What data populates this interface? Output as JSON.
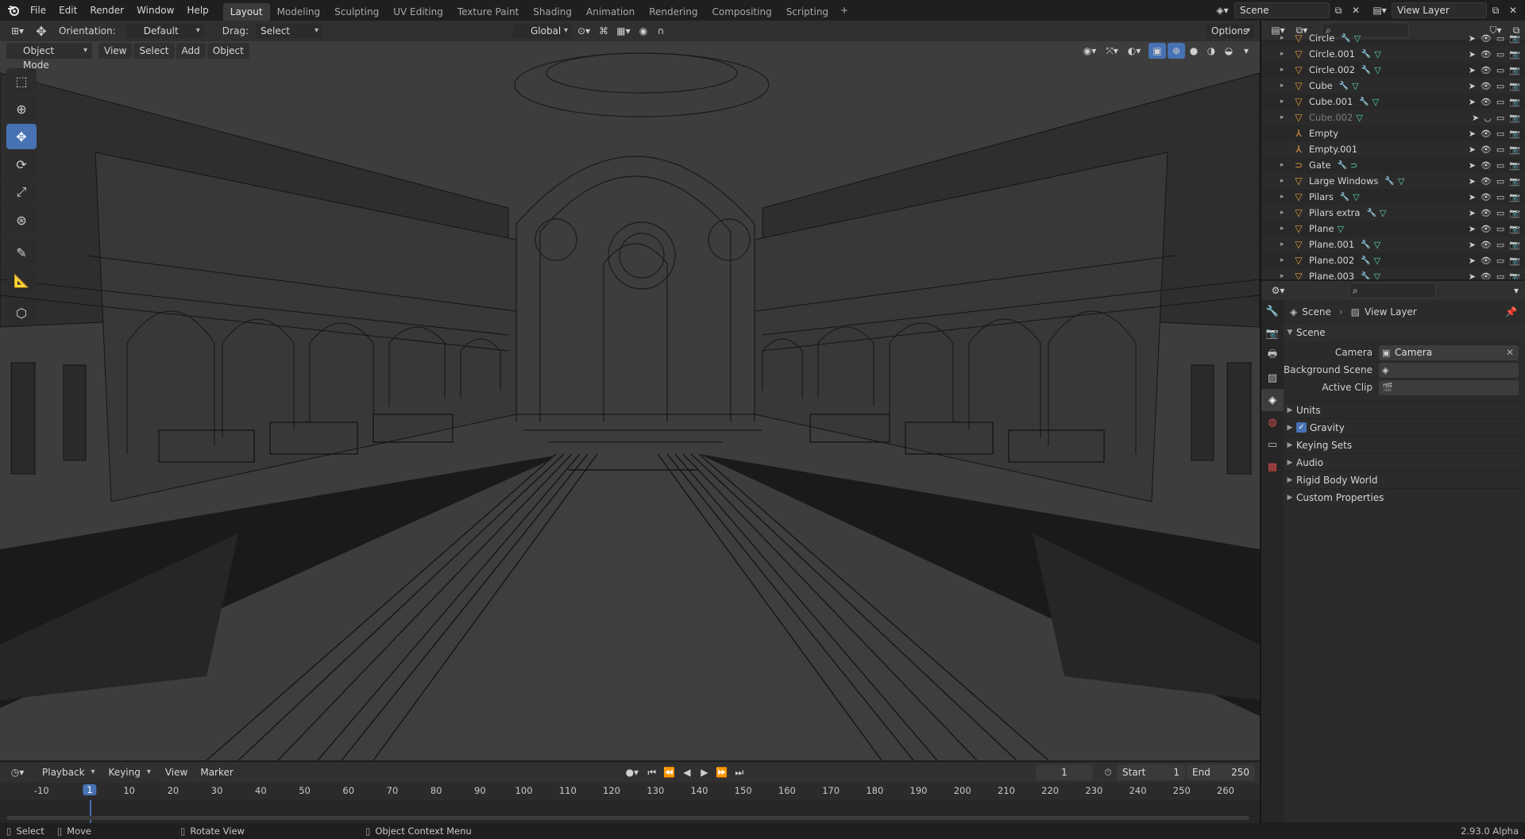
{
  "app": {
    "logo_icon": "blender-logo-icon"
  },
  "menu": [
    "File",
    "Edit",
    "Render",
    "Window",
    "Help"
  ],
  "workspaces": [
    "Layout",
    "Modeling",
    "Sculpting",
    "UV Editing",
    "Texture Paint",
    "Shading",
    "Animation",
    "Rendering",
    "Compositing",
    "Scripting"
  ],
  "active_workspace": "Layout",
  "scene_field": "Scene",
  "view_layer_field": "View Layer",
  "toolheader": {
    "orientation_label": "Orientation:",
    "orientation_value": "Default",
    "drag_label": "Drag:",
    "drag_value": "Select Box",
    "transform_orientation": "Global",
    "options": "Options"
  },
  "viewport_header": {
    "mode": "Object Mode",
    "menus": [
      "View",
      "Select",
      "Add",
      "Object"
    ]
  },
  "toolbar_icons": [
    "select-box-icon",
    "cursor-icon",
    "move-icon",
    "rotate-icon",
    "scale-icon",
    "transform-icon",
    "annotate-icon",
    "measure-icon",
    "add-cube-icon"
  ],
  "outliner": {
    "items": [
      {
        "name": "Circle",
        "mod": true,
        "data": true,
        "dim": false,
        "type": "mesh"
      },
      {
        "name": "Circle.001",
        "mod": true,
        "data": true,
        "dim": false,
        "type": "mesh"
      },
      {
        "name": "Circle.002",
        "mod": true,
        "data": true,
        "dim": false,
        "type": "mesh"
      },
      {
        "name": "Cube",
        "mod": true,
        "data": true,
        "dim": false,
        "type": "mesh"
      },
      {
        "name": "Cube.001",
        "mod": true,
        "data": true,
        "dim": false,
        "type": "mesh"
      },
      {
        "name": "Cube.002",
        "mod": false,
        "data": true,
        "dim": true,
        "type": "mesh"
      },
      {
        "name": "Empty",
        "mod": false,
        "data": false,
        "dim": false,
        "type": "empty"
      },
      {
        "name": "Empty.001",
        "mod": false,
        "data": false,
        "dim": false,
        "type": "empty"
      },
      {
        "name": "Gate",
        "mod": true,
        "data": true,
        "dim": false,
        "type": "curve"
      },
      {
        "name": "Large Windows",
        "mod": true,
        "data": true,
        "dim": false,
        "type": "mesh"
      },
      {
        "name": "Pilars",
        "mod": true,
        "data": true,
        "dim": false,
        "type": "mesh"
      },
      {
        "name": "Pilars extra",
        "mod": true,
        "data": true,
        "dim": false,
        "type": "mesh"
      },
      {
        "name": "Plane",
        "mod": false,
        "data": true,
        "dim": false,
        "type": "mesh"
      },
      {
        "name": "Plane.001",
        "mod": true,
        "data": true,
        "dim": false,
        "type": "mesh"
      },
      {
        "name": "Plane.002",
        "mod": true,
        "data": true,
        "dim": false,
        "type": "mesh"
      },
      {
        "name": "Plane.003",
        "mod": true,
        "data": true,
        "dim": false,
        "type": "mesh"
      }
    ]
  },
  "properties": {
    "breadcrumb": [
      "Scene",
      "View Layer"
    ],
    "section": "Scene",
    "fields": [
      {
        "label": "Camera",
        "value": "Camera"
      },
      {
        "label": "Background Scene",
        "value": ""
      },
      {
        "label": "Active Clip",
        "value": ""
      }
    ],
    "panels": [
      "Units",
      "Gravity",
      "Keying Sets",
      "Audio",
      "Rigid Body World",
      "Custom Properties"
    ],
    "gravity_checked": true
  },
  "timeline": {
    "menus": [
      "Playback",
      "Keying",
      "View",
      "Marker"
    ],
    "current_frame": "1",
    "start_label": "Start",
    "start": "1",
    "end_label": "End",
    "end": "250",
    "ticks": [
      "-10",
      "1",
      "10",
      "20",
      "30",
      "40",
      "50",
      "60",
      "70",
      "80",
      "90",
      "100",
      "110",
      "120",
      "130",
      "140",
      "150",
      "160",
      "170",
      "180",
      "190",
      "200",
      "210",
      "220",
      "230",
      "240",
      "250",
      "260"
    ]
  },
  "statusbar": {
    "items": [
      "Select",
      "Move",
      "Rotate View",
      "Object Context Menu"
    ],
    "version": "2.93.0 Alpha"
  }
}
